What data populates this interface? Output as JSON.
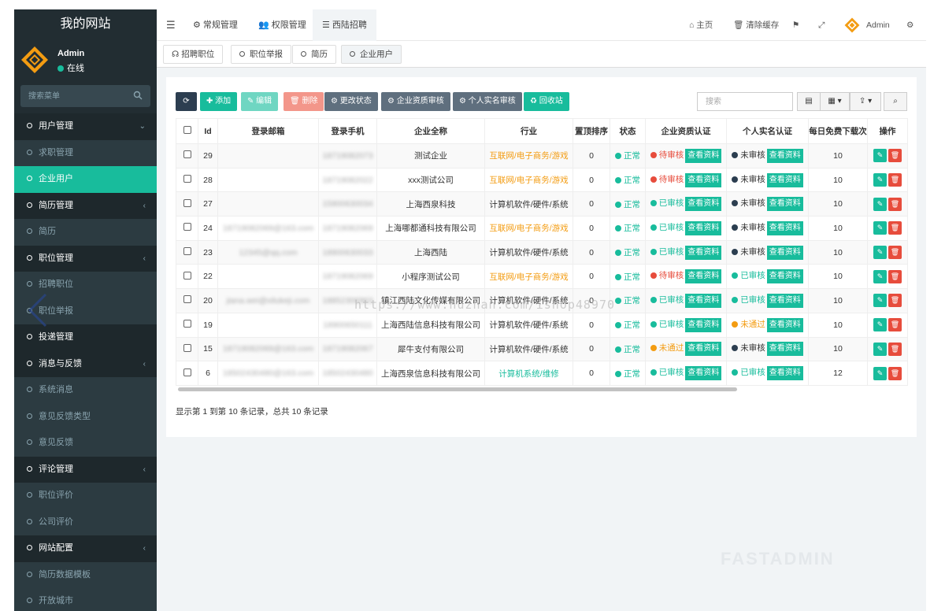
{
  "sidebar": {
    "site_title": "我的网站",
    "user_name": "Admin",
    "user_status": "在线",
    "search_placeholder": "搜索菜单",
    "items": [
      {
        "label": "用户管理",
        "type": "group",
        "chev": "⌄"
      },
      {
        "label": "求职管理",
        "type": "sub"
      },
      {
        "label": "企业用户",
        "type": "active"
      },
      {
        "label": "简历管理",
        "type": "group",
        "chev": "‹"
      },
      {
        "label": "简历",
        "type": "sub"
      },
      {
        "label": "职位管理",
        "type": "group",
        "chev": "‹"
      },
      {
        "label": "招聘职位",
        "type": "sub"
      },
      {
        "label": "职位举报",
        "type": "sub"
      },
      {
        "label": "投递管理",
        "type": "group"
      },
      {
        "label": "消息与反馈",
        "type": "group",
        "chev": "‹"
      },
      {
        "label": "系统消息",
        "type": "sub"
      },
      {
        "label": "意见反馈类型",
        "type": "sub"
      },
      {
        "label": "意见反馈",
        "type": "sub"
      },
      {
        "label": "评论管理",
        "type": "group",
        "chev": "‹"
      },
      {
        "label": "职位评价",
        "type": "sub"
      },
      {
        "label": "公司评价",
        "type": "sub"
      },
      {
        "label": "网站配置",
        "type": "group",
        "chev": "‹"
      },
      {
        "label": "简历数据模板",
        "type": "sub"
      },
      {
        "label": "开放城市",
        "type": "sub"
      }
    ]
  },
  "topbar": {
    "tabs": [
      "常规管理",
      "权限管理",
      "西陆招聘"
    ],
    "home": "主页",
    "clear_cache": "清除缓存",
    "admin": "Admin"
  },
  "subtabs": [
    "招聘职位",
    "职位举报",
    "简历",
    "企业用户"
  ],
  "toolbar": {
    "add": "添加",
    "edit": "编辑",
    "delete": "删除",
    "change_status": "更改状态",
    "qualify_review": "企业资质审核",
    "realname_review": "个人实名审核",
    "recycle": "回收站",
    "search_placeholder": "搜索"
  },
  "table": {
    "headers": [
      "Id",
      "登录邮箱",
      "登录手机",
      "企业全称",
      "行业",
      "置顶排序",
      "状态",
      "企业资质认证",
      "个人实名认证",
      "每日免费下载次",
      "操作"
    ],
    "view_label": "查看资料",
    "rows": [
      {
        "id": "29",
        "email": "",
        "phone": "18719082073",
        "company": "测试企业",
        "industry": "互联网/电子商务/游戏",
        "industry_color": "orange",
        "sort": "0",
        "status": "正常",
        "qual": "待审核",
        "qual_color": "red",
        "real": "未审核",
        "real_color": "dark",
        "free": "10"
      },
      {
        "id": "28",
        "email": "",
        "phone": "18719082022",
        "company": "xxx测试公司",
        "industry": "互联网/电子商务/游戏",
        "industry_color": "orange",
        "sort": "0",
        "status": "正常",
        "qual": "待审核",
        "qual_color": "red",
        "real": "未审核",
        "real_color": "dark",
        "free": "10"
      },
      {
        "id": "27",
        "email": "",
        "phone": "15900630034",
        "company": "上海西泉科技",
        "industry": "计算机软件/硬件/系统",
        "industry_color": "dark",
        "sort": "0",
        "status": "正常",
        "qual": "已审核",
        "qual_color": "green",
        "real": "未审核",
        "real_color": "dark",
        "free": "10"
      },
      {
        "id": "24",
        "email": "18719082069@163.com",
        "phone": "18719082069",
        "company": "上海哪都通科技有限公司",
        "industry": "互联网/电子商务/游戏",
        "industry_color": "orange",
        "sort": "0",
        "status": "正常",
        "qual": "已审核",
        "qual_color": "green",
        "real": "未审核",
        "real_color": "dark",
        "free": "10"
      },
      {
        "id": "23",
        "email": "12345@qq.com",
        "phone": "18900630033",
        "company": "上海西陆",
        "industry": "计算机软件/硬件/系统",
        "industry_color": "dark",
        "sort": "0",
        "status": "正常",
        "qual": "已审核",
        "qual_color": "green",
        "real": "未审核",
        "real_color": "dark",
        "free": "10"
      },
      {
        "id": "22",
        "email": "",
        "phone": "18719082069",
        "company": "小程序测试公司",
        "industry": "互联网/电子商务/游戏",
        "industry_color": "orange",
        "sort": "0",
        "status": "正常",
        "qual": "待审核",
        "qual_color": "red",
        "real": "已审核",
        "real_color": "green",
        "free": "10"
      },
      {
        "id": "20",
        "email": "jiana.wei@xilukeji.com",
        "phone": "18852306963",
        "company": "镇江西陆文化传媒有限公司",
        "industry": "计算机软件/硬件/系统",
        "industry_color": "dark",
        "sort": "0",
        "status": "正常",
        "qual": "已审核",
        "qual_color": "green",
        "real": "已审核",
        "real_color": "green",
        "free": "10"
      },
      {
        "id": "19",
        "email": "",
        "phone": "18900650111",
        "company": "上海西陆信息科技有限公司",
        "industry": "计算机软件/硬件/系统",
        "industry_color": "dark",
        "sort": "0",
        "status": "正常",
        "qual": "已审核",
        "qual_color": "green",
        "real": "未通过",
        "real_color": "orange",
        "free": "10"
      },
      {
        "id": "15",
        "email": "18719082069@163.com",
        "phone": "18719082067",
        "company": "犀牛支付有限公司",
        "industry": "计算机软件/硬件/系统",
        "industry_color": "dark",
        "sort": "0",
        "status": "正常",
        "qual": "未通过",
        "qual_color": "orange",
        "real": "未审核",
        "real_color": "dark",
        "free": "10"
      },
      {
        "id": "6",
        "email": "18502430480@163.com",
        "phone": "18502430480",
        "company": "上海西泉信息科技有限公司",
        "industry": "计算机系统/维修",
        "industry_color": "teal",
        "sort": "0",
        "status": "正常",
        "qual": "已审核",
        "qual_color": "green",
        "real": "已审核",
        "real_color": "green",
        "free": "12"
      }
    ]
  },
  "footer_info": "显示第 1 到第 10 条记录，总共 10 条记录",
  "watermark": "https://www.huzhan.com/ishop48970",
  "brand_watermark": "FASTADMIN",
  "colors": {
    "accent": "#18bc9c",
    "sidebar": "#222d32",
    "danger": "#e74c3c",
    "warning": "#f39c12"
  }
}
